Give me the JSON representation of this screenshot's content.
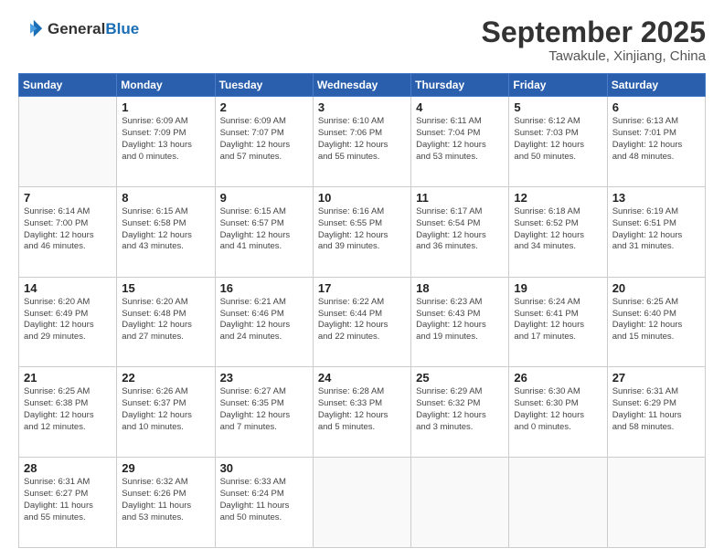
{
  "header": {
    "logo_general": "General",
    "logo_blue": "Blue",
    "month": "September 2025",
    "location": "Tawakule, Xinjiang, China"
  },
  "days_of_week": [
    "Sunday",
    "Monday",
    "Tuesday",
    "Wednesday",
    "Thursday",
    "Friday",
    "Saturday"
  ],
  "weeks": [
    [
      {
        "day": "",
        "info": ""
      },
      {
        "day": "1",
        "info": "Sunrise: 6:09 AM\nSunset: 7:09 PM\nDaylight: 13 hours\nand 0 minutes."
      },
      {
        "day": "2",
        "info": "Sunrise: 6:09 AM\nSunset: 7:07 PM\nDaylight: 12 hours\nand 57 minutes."
      },
      {
        "day": "3",
        "info": "Sunrise: 6:10 AM\nSunset: 7:06 PM\nDaylight: 12 hours\nand 55 minutes."
      },
      {
        "day": "4",
        "info": "Sunrise: 6:11 AM\nSunset: 7:04 PM\nDaylight: 12 hours\nand 53 minutes."
      },
      {
        "day": "5",
        "info": "Sunrise: 6:12 AM\nSunset: 7:03 PM\nDaylight: 12 hours\nand 50 minutes."
      },
      {
        "day": "6",
        "info": "Sunrise: 6:13 AM\nSunset: 7:01 PM\nDaylight: 12 hours\nand 48 minutes."
      }
    ],
    [
      {
        "day": "7",
        "info": "Sunrise: 6:14 AM\nSunset: 7:00 PM\nDaylight: 12 hours\nand 46 minutes."
      },
      {
        "day": "8",
        "info": "Sunrise: 6:15 AM\nSunset: 6:58 PM\nDaylight: 12 hours\nand 43 minutes."
      },
      {
        "day": "9",
        "info": "Sunrise: 6:15 AM\nSunset: 6:57 PM\nDaylight: 12 hours\nand 41 minutes."
      },
      {
        "day": "10",
        "info": "Sunrise: 6:16 AM\nSunset: 6:55 PM\nDaylight: 12 hours\nand 39 minutes."
      },
      {
        "day": "11",
        "info": "Sunrise: 6:17 AM\nSunset: 6:54 PM\nDaylight: 12 hours\nand 36 minutes."
      },
      {
        "day": "12",
        "info": "Sunrise: 6:18 AM\nSunset: 6:52 PM\nDaylight: 12 hours\nand 34 minutes."
      },
      {
        "day": "13",
        "info": "Sunrise: 6:19 AM\nSunset: 6:51 PM\nDaylight: 12 hours\nand 31 minutes."
      }
    ],
    [
      {
        "day": "14",
        "info": "Sunrise: 6:20 AM\nSunset: 6:49 PM\nDaylight: 12 hours\nand 29 minutes."
      },
      {
        "day": "15",
        "info": "Sunrise: 6:20 AM\nSunset: 6:48 PM\nDaylight: 12 hours\nand 27 minutes."
      },
      {
        "day": "16",
        "info": "Sunrise: 6:21 AM\nSunset: 6:46 PM\nDaylight: 12 hours\nand 24 minutes."
      },
      {
        "day": "17",
        "info": "Sunrise: 6:22 AM\nSunset: 6:44 PM\nDaylight: 12 hours\nand 22 minutes."
      },
      {
        "day": "18",
        "info": "Sunrise: 6:23 AM\nSunset: 6:43 PM\nDaylight: 12 hours\nand 19 minutes."
      },
      {
        "day": "19",
        "info": "Sunrise: 6:24 AM\nSunset: 6:41 PM\nDaylight: 12 hours\nand 17 minutes."
      },
      {
        "day": "20",
        "info": "Sunrise: 6:25 AM\nSunset: 6:40 PM\nDaylight: 12 hours\nand 15 minutes."
      }
    ],
    [
      {
        "day": "21",
        "info": "Sunrise: 6:25 AM\nSunset: 6:38 PM\nDaylight: 12 hours\nand 12 minutes."
      },
      {
        "day": "22",
        "info": "Sunrise: 6:26 AM\nSunset: 6:37 PM\nDaylight: 12 hours\nand 10 minutes."
      },
      {
        "day": "23",
        "info": "Sunrise: 6:27 AM\nSunset: 6:35 PM\nDaylight: 12 hours\nand 7 minutes."
      },
      {
        "day": "24",
        "info": "Sunrise: 6:28 AM\nSunset: 6:33 PM\nDaylight: 12 hours\nand 5 minutes."
      },
      {
        "day": "25",
        "info": "Sunrise: 6:29 AM\nSunset: 6:32 PM\nDaylight: 12 hours\nand 3 minutes."
      },
      {
        "day": "26",
        "info": "Sunrise: 6:30 AM\nSunset: 6:30 PM\nDaylight: 12 hours\nand 0 minutes."
      },
      {
        "day": "27",
        "info": "Sunrise: 6:31 AM\nSunset: 6:29 PM\nDaylight: 11 hours\nand 58 minutes."
      }
    ],
    [
      {
        "day": "28",
        "info": "Sunrise: 6:31 AM\nSunset: 6:27 PM\nDaylight: 11 hours\nand 55 minutes."
      },
      {
        "day": "29",
        "info": "Sunrise: 6:32 AM\nSunset: 6:26 PM\nDaylight: 11 hours\nand 53 minutes."
      },
      {
        "day": "30",
        "info": "Sunrise: 6:33 AM\nSunset: 6:24 PM\nDaylight: 11 hours\nand 50 minutes."
      },
      {
        "day": "",
        "info": ""
      },
      {
        "day": "",
        "info": ""
      },
      {
        "day": "",
        "info": ""
      },
      {
        "day": "",
        "info": ""
      }
    ]
  ]
}
